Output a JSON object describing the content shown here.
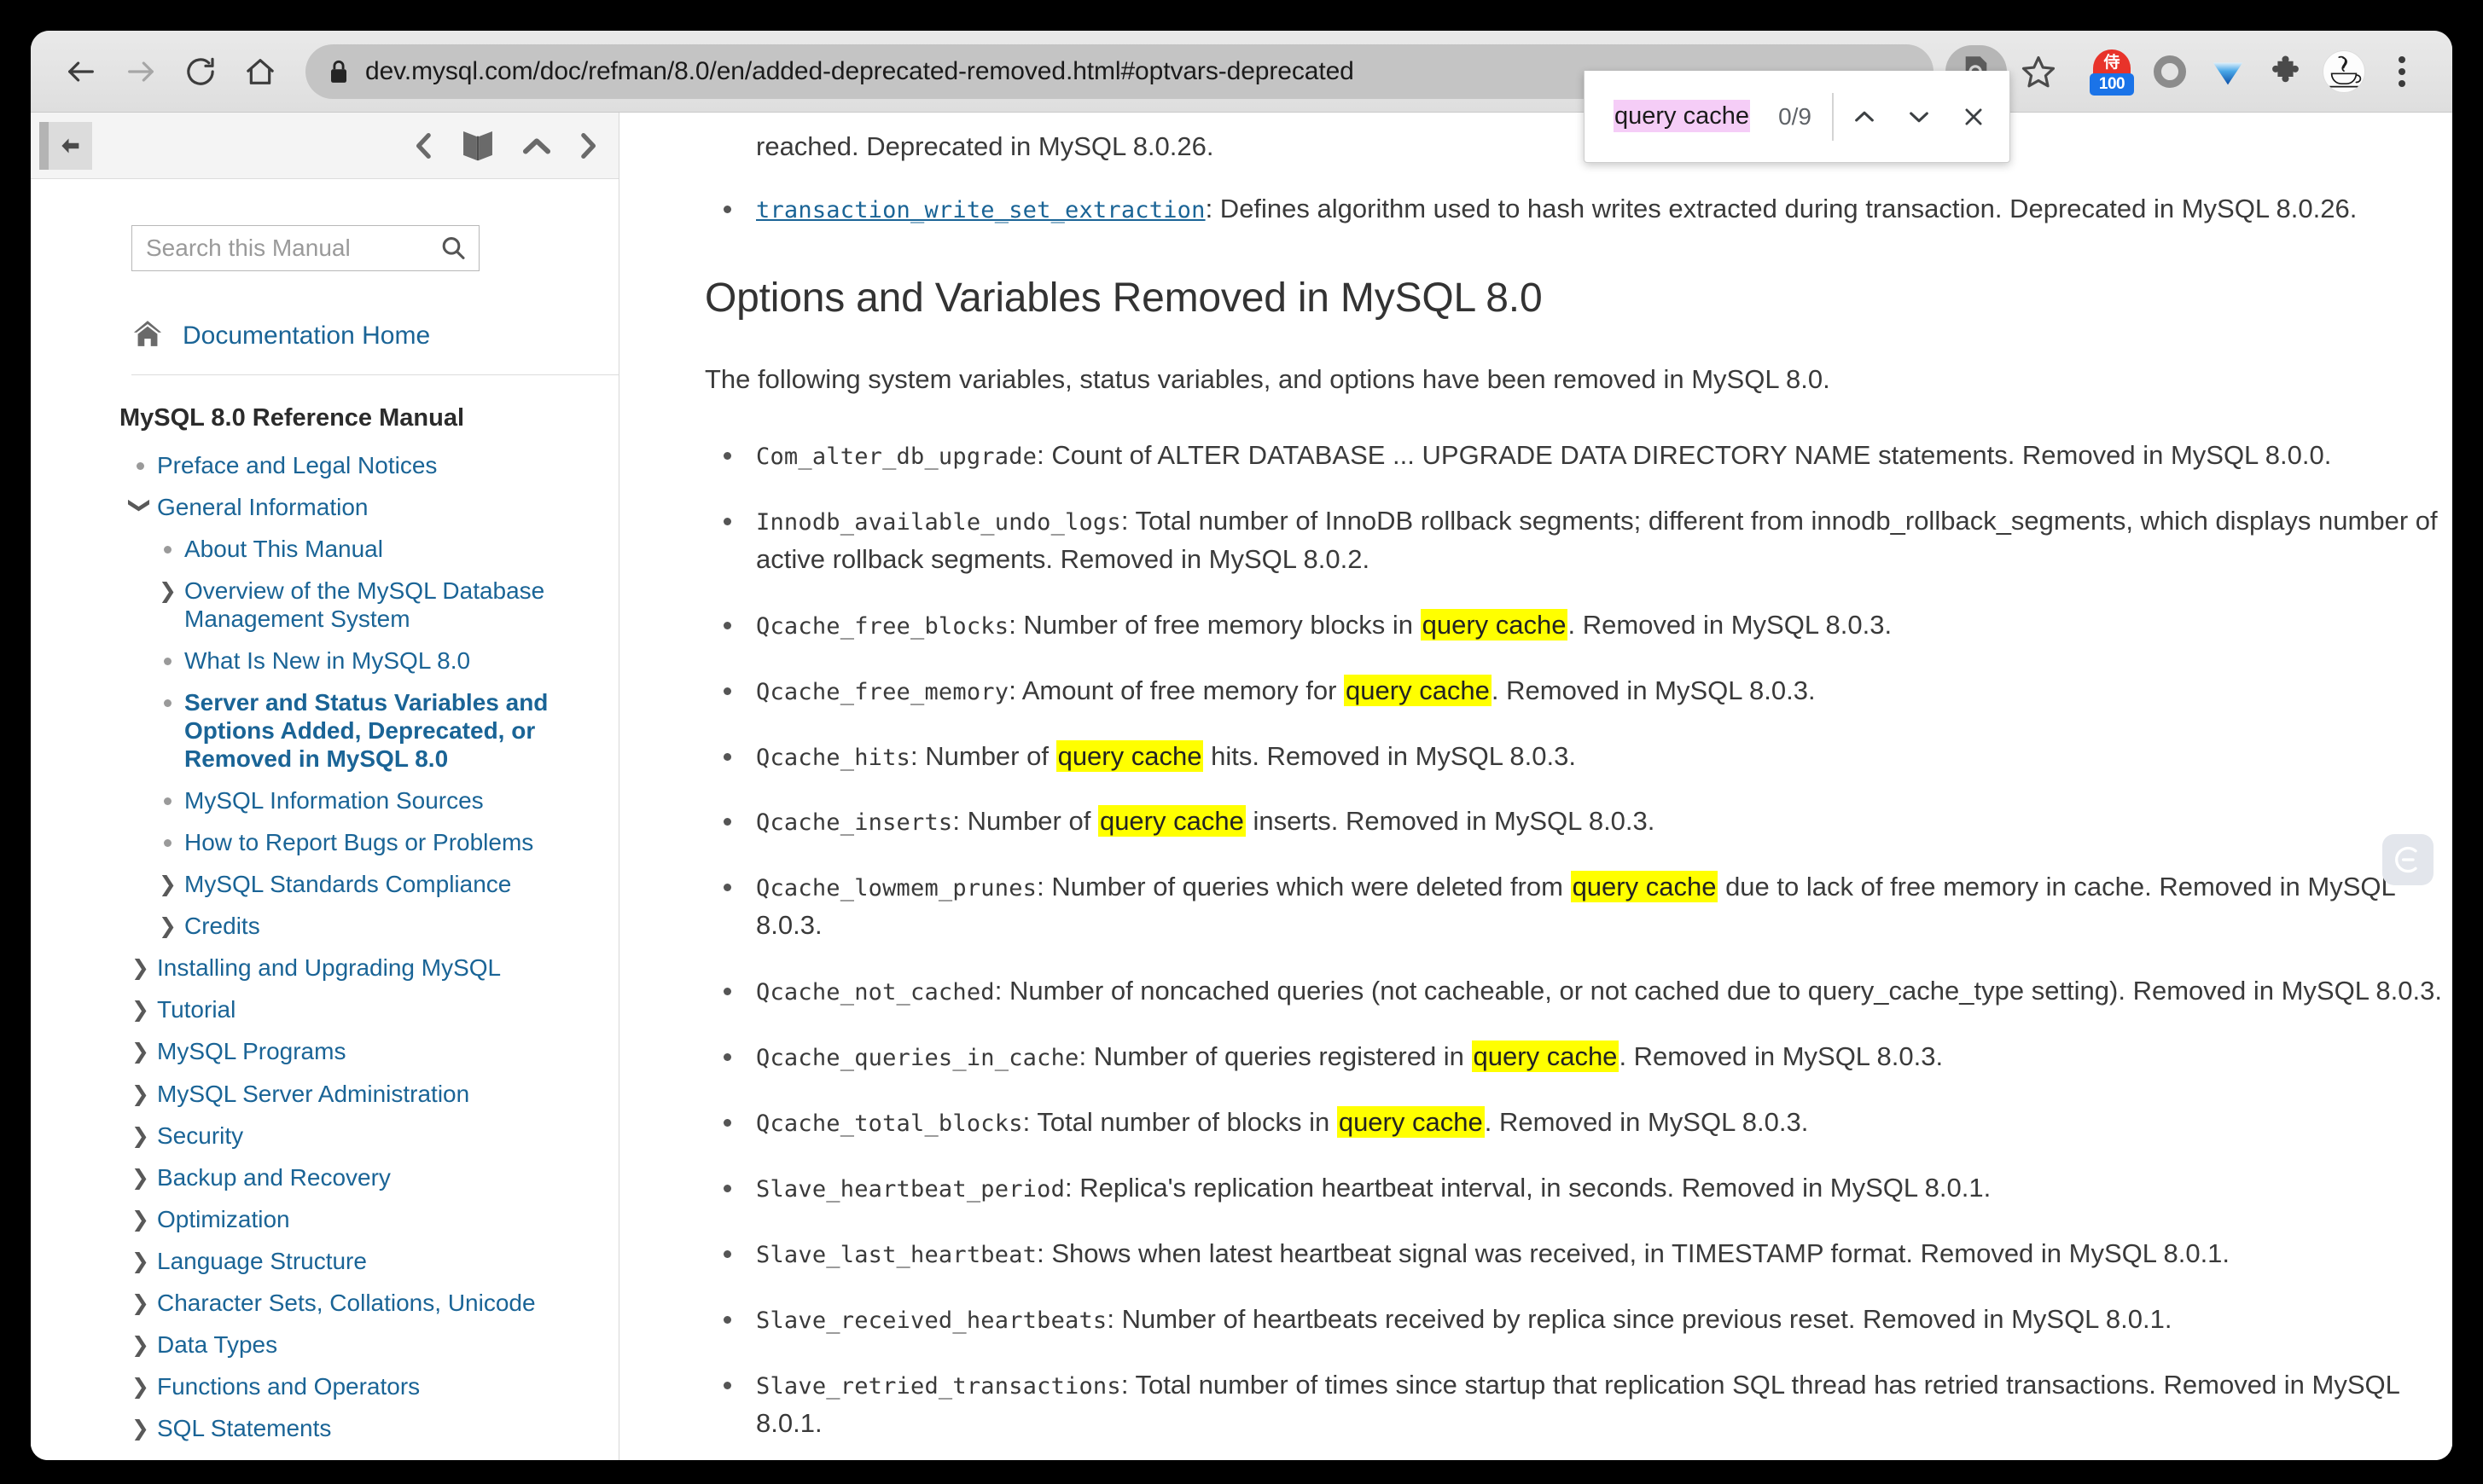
{
  "browser": {
    "url": "dev.mysql.com/doc/refman/8.0/en/added-deprecated-removed.html#optvars-deprecated",
    "back_label": "Back",
    "forward_label": "Forward",
    "reload_label": "Reload",
    "home_label": "Home",
    "lock_icon": "lock-icon",
    "reader_icon": "reader-mode-icon",
    "star_icon": "bookmark-star-icon",
    "extensions": [
      {
        "name": "extension-badge-100",
        "badge": "100",
        "glyph": "侍"
      },
      {
        "name": "extension-ring",
        "badge": ""
      },
      {
        "name": "extension-diamond",
        "badge": ""
      },
      {
        "name": "extension-puzzle",
        "badge": ""
      }
    ],
    "avatar_icon": "profile-avatar",
    "menu_icon": "three-dot-menu-icon"
  },
  "find_bar": {
    "query": "query cache",
    "count": "0/9",
    "prev_icon": "chevron-up-icon",
    "next_icon": "chevron-down-icon",
    "close_icon": "close-icon"
  },
  "sidebar": {
    "collapse_icon": "collapse-sidebar-icon",
    "nav_icons": [
      {
        "name": "prev-page-icon",
        "glyph": "chevron-left"
      },
      {
        "name": "open-book-icon",
        "glyph": "book"
      },
      {
        "name": "up-page-icon",
        "glyph": "chevron-up"
      },
      {
        "name": "next-page-icon",
        "glyph": "chevron-right"
      }
    ],
    "search": {
      "placeholder": "Search this Manual",
      "value": "",
      "icon": "search-icon"
    },
    "home": {
      "label": "Documentation Home",
      "icon": "home-icon"
    },
    "manual_title": "MySQL 8.0 Reference Manual",
    "items": [
      {
        "label": "Preface and Legal Notices",
        "level": 0,
        "marker": "dot",
        "current": false
      },
      {
        "label": "General Information",
        "level": 0,
        "marker": "chevron-down",
        "current": false
      },
      {
        "label": "About This Manual",
        "level": 1,
        "marker": "dot",
        "current": false
      },
      {
        "label": "Overview of the MySQL Database Management System",
        "level": 1,
        "marker": "chevron-right",
        "current": false
      },
      {
        "label": "What Is New in MySQL 8.0",
        "level": 1,
        "marker": "dot",
        "current": false
      },
      {
        "label": "Server and Status Variables and Options Added, Deprecated, or Removed in MySQL 8.0",
        "level": 1,
        "marker": "dot",
        "current": true
      },
      {
        "label": "MySQL Information Sources",
        "level": 1,
        "marker": "dot",
        "current": false
      },
      {
        "label": "How to Report Bugs or Problems",
        "level": 1,
        "marker": "dot",
        "current": false
      },
      {
        "label": "MySQL Standards Compliance",
        "level": 1,
        "marker": "chevron-right",
        "current": false
      },
      {
        "label": "Credits",
        "level": 1,
        "marker": "chevron-right",
        "current": false
      },
      {
        "label": "Installing and Upgrading MySQL",
        "level": 0,
        "marker": "chevron-right",
        "current": false
      },
      {
        "label": "Tutorial",
        "level": 0,
        "marker": "chevron-right",
        "current": false
      },
      {
        "label": "MySQL Programs",
        "level": 0,
        "marker": "chevron-right",
        "current": false
      },
      {
        "label": "MySQL Server Administration",
        "level": 0,
        "marker": "chevron-right",
        "current": false
      },
      {
        "label": "Security",
        "level": 0,
        "marker": "chevron-right",
        "current": false
      },
      {
        "label": "Backup and Recovery",
        "level": 0,
        "marker": "chevron-right",
        "current": false
      },
      {
        "label": "Optimization",
        "level": 0,
        "marker": "chevron-right",
        "current": false
      },
      {
        "label": "Language Structure",
        "level": 0,
        "marker": "chevron-right",
        "current": false
      },
      {
        "label": "Character Sets, Collations, Unicode",
        "level": 0,
        "marker": "chevron-right",
        "current": false
      },
      {
        "label": "Data Types",
        "level": 0,
        "marker": "chevron-right",
        "current": false
      },
      {
        "label": "Functions and Operators",
        "level": 0,
        "marker": "chevron-right",
        "current": false
      },
      {
        "label": "SQL Statements",
        "level": 0,
        "marker": "chevron-right",
        "current": false
      }
    ]
  },
  "content": {
    "clipped_top_line": "reached. Deprecated in MySQL 8.0.26.",
    "clipped_item": {
      "code": "transaction_write_set_extraction",
      "text": ": Defines algorithm used to hash writes extracted during transaction. Deprecated in MySQL 8.0.26."
    },
    "section_title": "Options and Variables Removed in MySQL 8.0",
    "section_intro": "The following system variables, status variables, and options have been removed in MySQL 8.0.",
    "highlight_term": "query cache",
    "items": [
      {
        "code": "Com_alter_db_upgrade",
        "parts": [
          {
            "t": ": Count of ALTER DATABASE ... UPGRADE DATA DIRECTORY NAME statements. Removed in MySQL 8.0.0."
          }
        ]
      },
      {
        "code": "Innodb_available_undo_logs",
        "parts": [
          {
            "t": ": Total number of InnoDB rollback segments; different from innodb_rollback_segments, which displays number of active rollback segments. Removed in MySQL 8.0.2."
          }
        ]
      },
      {
        "code": "Qcache_free_blocks",
        "parts": [
          {
            "t": ": Number of free memory blocks in "
          },
          {
            "t": "query cache",
            "hl": true
          },
          {
            "t": ". Removed in MySQL 8.0.3."
          }
        ]
      },
      {
        "code": "Qcache_free_memory",
        "parts": [
          {
            "t": ": Amount of free memory for "
          },
          {
            "t": "query cache",
            "hl": true
          },
          {
            "t": ". Removed in MySQL 8.0.3."
          }
        ]
      },
      {
        "code": "Qcache_hits",
        "parts": [
          {
            "t": ": Number of "
          },
          {
            "t": "query cache",
            "hl": true
          },
          {
            "t": " hits. Removed in MySQL 8.0.3."
          }
        ]
      },
      {
        "code": "Qcache_inserts",
        "parts": [
          {
            "t": ": Number of "
          },
          {
            "t": "query cache",
            "hl": true
          },
          {
            "t": " inserts. Removed in MySQL 8.0.3."
          }
        ]
      },
      {
        "code": "Qcache_lowmem_prunes",
        "parts": [
          {
            "t": ": Number of queries which were deleted from "
          },
          {
            "t": "query cache",
            "hl": true
          },
          {
            "t": " due to lack of free memory in cache. Removed in MySQL 8.0.3."
          }
        ]
      },
      {
        "code": "Qcache_not_cached",
        "parts": [
          {
            "t": ": Number of noncached queries (not cacheable, or not cached due to query_cache_type setting). Removed in MySQL 8.0.3."
          }
        ]
      },
      {
        "code": "Qcache_queries_in_cache",
        "parts": [
          {
            "t": ": Number of queries registered in "
          },
          {
            "t": "query cache",
            "hl": true
          },
          {
            "t": ". Removed in MySQL 8.0.3."
          }
        ]
      },
      {
        "code": "Qcache_total_blocks",
        "parts": [
          {
            "t": ": Total number of blocks in "
          },
          {
            "t": "query cache",
            "hl": true
          },
          {
            "t": ". Removed in MySQL 8.0.3."
          }
        ]
      },
      {
        "code": "Slave_heartbeat_period",
        "parts": [
          {
            "t": ": Replica's replication heartbeat interval, in seconds. Removed in MySQL 8.0.1."
          }
        ]
      },
      {
        "code": "Slave_last_heartbeat",
        "parts": [
          {
            "t": ": Shows when latest heartbeat signal was received, in TIMESTAMP format. Removed in MySQL 8.0.1."
          }
        ]
      },
      {
        "code": "Slave_received_heartbeats",
        "parts": [
          {
            "t": ": Number of heartbeats received by replica since previous reset. Removed in MySQL 8.0.1."
          }
        ]
      },
      {
        "code": "Slave_retried_transactions",
        "parts": [
          {
            "t": ": Total number of times since startup that replication SQL thread has retried transactions. Removed in MySQL 8.0.1."
          }
        ]
      }
    ],
    "feedback_icon": "feedback-tab-icon"
  },
  "colors": {
    "link": "#1a6496",
    "highlight": "#ffff00",
    "find_selection": "#f5cdf7",
    "badge_blue": "#1a73e8",
    "badge_red": "#e8332a"
  }
}
